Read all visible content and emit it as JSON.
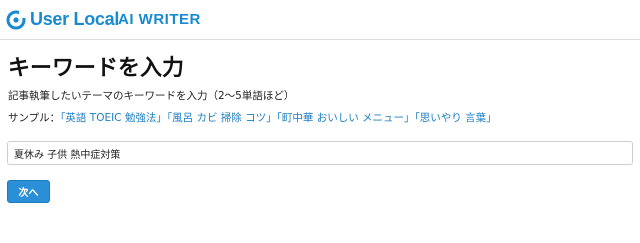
{
  "header": {
    "brand": "User Local",
    "product": "AI WRITER",
    "accent_color": "#1a8ad0",
    "logo_icon": "user-local-logo-icon"
  },
  "main": {
    "title": "キーワードを入力",
    "instruction": "記事執筆したいテーマのキーワードを入力（2〜5単語ほど）",
    "samples_label": "サンプル：",
    "samples": [
      "「英語 TOEIC 勉強法」",
      "「風呂 カビ 掃除 コツ」",
      "「町中華 おいしい メニュー」",
      "「思いやり 言葉」"
    ],
    "link_color": "#1e7fc4",
    "keyword_input": {
      "value": "夏休み 子供 熱中症対策",
      "placeholder": ""
    },
    "next_button": "次へ",
    "button_color": "#2a8fd6"
  }
}
